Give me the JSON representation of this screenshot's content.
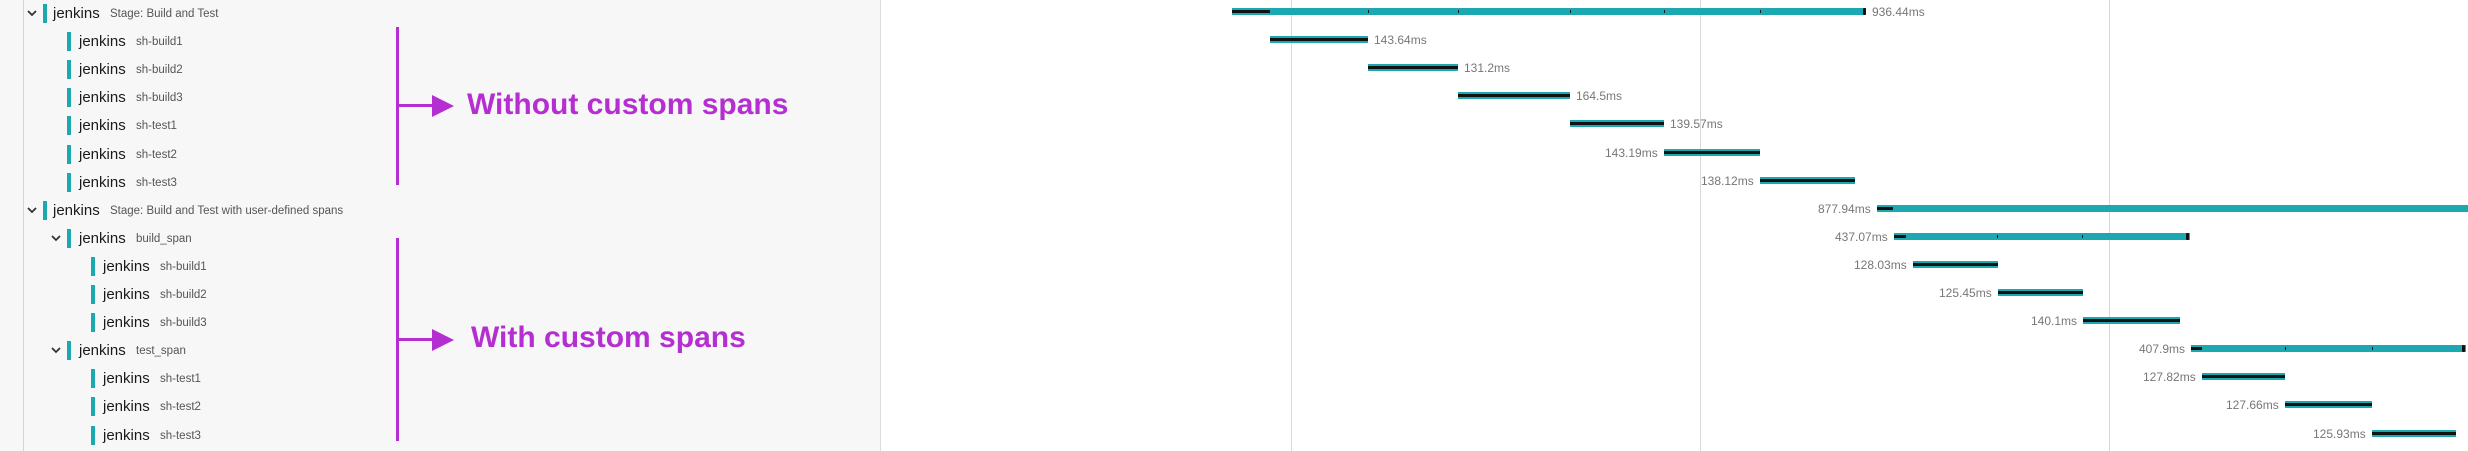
{
  "accent_color": "#1ba8b0",
  "annotation_color": "#b52ed1",
  "rows": [
    {
      "service": "jenkins",
      "operation": "Stage: Build and Test",
      "duration": "936.44ms",
      "expandable": true
    },
    {
      "service": "jenkins",
      "operation": "sh-build1",
      "duration": "143.64ms",
      "expandable": false
    },
    {
      "service": "jenkins",
      "operation": "sh-build2",
      "duration": "131.2ms",
      "expandable": false
    },
    {
      "service": "jenkins",
      "operation": "sh-build3",
      "duration": "164.5ms",
      "expandable": false
    },
    {
      "service": "jenkins",
      "operation": "sh-test1",
      "duration": "139.57ms",
      "expandable": false
    },
    {
      "service": "jenkins",
      "operation": "sh-test2",
      "duration": "143.19ms",
      "expandable": false
    },
    {
      "service": "jenkins",
      "operation": "sh-test3",
      "duration": "138.12ms",
      "expandable": false
    },
    {
      "service": "jenkins",
      "operation": "Stage: Build and Test with user-defined spans",
      "duration": "877.94ms",
      "expandable": true
    },
    {
      "service": "jenkins",
      "operation": "build_span",
      "duration": "437.07ms",
      "expandable": true
    },
    {
      "service": "jenkins",
      "operation": "sh-build1",
      "duration": "128.03ms",
      "expandable": false
    },
    {
      "service": "jenkins",
      "operation": "sh-build2",
      "duration": "125.45ms",
      "expandable": false
    },
    {
      "service": "jenkins",
      "operation": "sh-build3",
      "duration": "140.1ms",
      "expandable": false
    },
    {
      "service": "jenkins",
      "operation": "test_span",
      "duration": "407.9ms",
      "expandable": true
    },
    {
      "service": "jenkins",
      "operation": "sh-test1",
      "duration": "127.82ms",
      "expandable": false
    },
    {
      "service": "jenkins",
      "operation": "sh-test2",
      "duration": "127.66ms",
      "expandable": false
    },
    {
      "service": "jenkins",
      "operation": "sh-test3",
      "duration": "125.93ms",
      "expandable": false
    }
  ],
  "annotations": {
    "without": "Without custom spans",
    "with": "With custom spans"
  }
}
